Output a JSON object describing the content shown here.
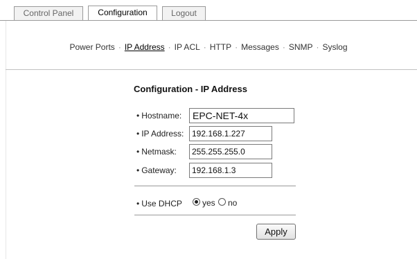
{
  "tabs": [
    {
      "label": "Control Panel"
    },
    {
      "label": "Configuration"
    },
    {
      "label": "Logout"
    }
  ],
  "subnav": {
    "items": [
      "Power Ports",
      "IP Address",
      "IP ACL",
      "HTTP",
      "Messages",
      "SNMP",
      "Syslog"
    ],
    "separator": "·"
  },
  "form": {
    "title": "Configuration - IP Address",
    "hostname_label": "Hostname:",
    "hostname_value": "EPC-NET-4x",
    "ip_label": "IP Address:",
    "ip_value": "192.168.1.227",
    "netmask_label": "Netmask:",
    "netmask_value": "255.255.255.0",
    "gateway_label": "Gateway:",
    "gateway_value": "192.168.1.3",
    "dhcp_label": "Use DHCP",
    "dhcp_yes": "yes",
    "dhcp_no": "no",
    "dhcp_selected": "yes",
    "apply_label": "Apply"
  }
}
